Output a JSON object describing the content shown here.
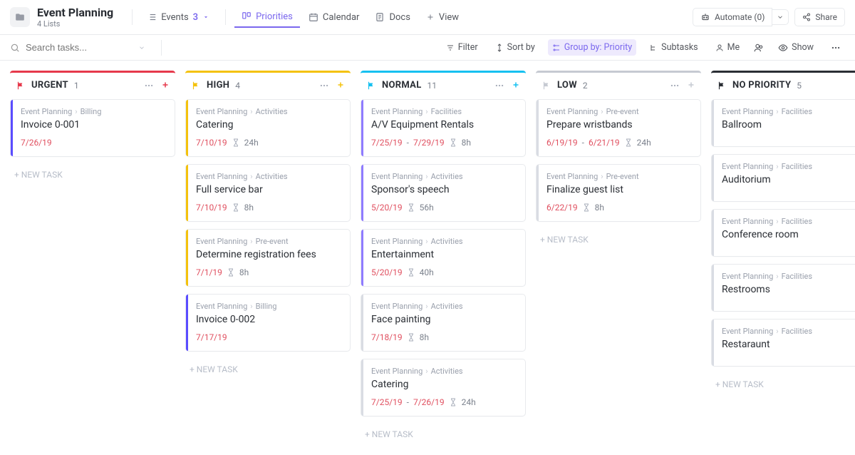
{
  "header": {
    "title": "Event Planning",
    "subtitle": "4 Lists",
    "tabs": {
      "events": "Events",
      "events_count": "3",
      "priorities": "Priorities",
      "calendar": "Calendar",
      "docs": "Docs",
      "view": "View"
    },
    "automate": "Automate (0)",
    "share": "Share"
  },
  "toolbar": {
    "search_placeholder": "Search tasks...",
    "filter": "Filter",
    "sort": "Sort by",
    "group": "Group by: Priority",
    "subtasks": "Subtasks",
    "me": "Me",
    "show": "Show"
  },
  "newtask_label": "+ NEW TASK",
  "columns": [
    {
      "key": "urgent",
      "title": "URGENT",
      "count": "1",
      "color": "#e6394b",
      "add_color": "#e6394b",
      "cards": [
        {
          "breadcrumb": [
            "Event Planning",
            "Billing"
          ],
          "title": "Invoice 0-001",
          "date": "7/26/19",
          "accent": "#5a4cff"
        }
      ]
    },
    {
      "key": "high",
      "title": "HIGH",
      "count": "4",
      "color": "#f4c20d",
      "add_color": "#f4c20d",
      "cards": [
        {
          "breadcrumb": [
            "Event Planning",
            "Activities"
          ],
          "title": "Catering",
          "date": "7/10/19",
          "hours": "24h",
          "accent": "#f4c20d"
        },
        {
          "breadcrumb": [
            "Event Planning",
            "Activities"
          ],
          "title": "Full service bar",
          "date": "7/10/19",
          "hours": "8h",
          "accent": "#f4c20d"
        },
        {
          "breadcrumb": [
            "Event Planning",
            "Pre-event"
          ],
          "title": "Determine registration fees",
          "date": "7/1/19",
          "hours": "8h",
          "accent": "#f4c20d"
        },
        {
          "breadcrumb": [
            "Event Planning",
            "Billing"
          ],
          "title": "Invoice 0-002",
          "date": "7/17/19",
          "accent": "#5a4cff"
        }
      ]
    },
    {
      "key": "normal",
      "title": "NORMAL",
      "count": "11",
      "color": "#16c0f0",
      "add_color": "#16c0f0",
      "cards": [
        {
          "breadcrumb": [
            "Event Planning",
            "Facilities"
          ],
          "title": "A/V Equipment Rentals",
          "date": "7/25/19",
          "date2": "7/29/19",
          "hours": "8h",
          "accent": "#8f7bff"
        },
        {
          "breadcrumb": [
            "Event Planning",
            "Activities"
          ],
          "title": "Sponsor's speech",
          "date": "5/20/19",
          "hours": "56h",
          "accent": "#8f7bff"
        },
        {
          "breadcrumb": [
            "Event Planning",
            "Activities"
          ],
          "title": "Entertainment",
          "date": "5/20/19",
          "hours": "40h",
          "accent": "#8f7bff"
        },
        {
          "breadcrumb": [
            "Event Planning",
            "Activities"
          ],
          "title": "Face painting",
          "date": "7/18/19",
          "hours": "8h",
          "accent": "#d9dce3"
        },
        {
          "breadcrumb": [
            "Event Planning",
            "Activities"
          ],
          "title": "Catering",
          "date": "7/25/19",
          "date2": "7/26/19",
          "hours": "24h",
          "accent": "#d9dce3"
        }
      ]
    },
    {
      "key": "low",
      "title": "LOW",
      "count": "2",
      "color": "#c6cad2",
      "add_color": "#c6cad2",
      "cards": [
        {
          "breadcrumb": [
            "Event Planning",
            "Pre-event"
          ],
          "title": "Prepare wristbands",
          "date": "6/19/19",
          "date2": "6/21/19",
          "hours": "24h",
          "accent": "#d9dce3"
        },
        {
          "breadcrumb": [
            "Event Planning",
            "Pre-event"
          ],
          "title": "Finalize guest list",
          "date": "6/22/19",
          "hours": "8h",
          "accent": "#d9dce3"
        }
      ]
    },
    {
      "key": "none",
      "title": "NO PRIORITY",
      "count": "5",
      "color": "#2a2e34",
      "add_hidden": true,
      "cards": [
        {
          "breadcrumb": [
            "Event Planning",
            "Facilities"
          ],
          "title": "Ballroom",
          "accent": "#d9dce3"
        },
        {
          "breadcrumb": [
            "Event Planning",
            "Facilities"
          ],
          "title": "Auditorium",
          "accent": "#d9dce3"
        },
        {
          "breadcrumb": [
            "Event Planning",
            "Facilities"
          ],
          "title": "Conference room",
          "accent": "#d9dce3"
        },
        {
          "breadcrumb": [
            "Event Planning",
            "Facilities"
          ],
          "title": "Restrooms",
          "accent": "#d9dce3"
        },
        {
          "breadcrumb": [
            "Event Planning",
            "Facilities"
          ],
          "title": "Restaraunt",
          "accent": "#d9dce3"
        }
      ]
    }
  ]
}
